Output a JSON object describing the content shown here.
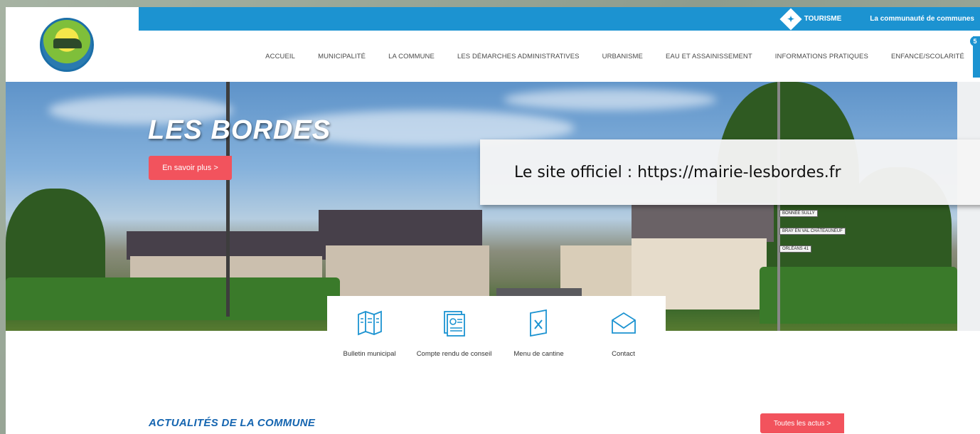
{
  "topbar": {
    "tourisme_label": "TOURISME",
    "communaute_label": "La communauté de communes"
  },
  "nav": {
    "items": [
      {
        "label": "ACCUEIL"
      },
      {
        "label": "MUNICIPALITÉ"
      },
      {
        "label": "LA COMMUNE"
      },
      {
        "label": "LES DÉMARCHES ADMINISTRATIVES"
      },
      {
        "label": "URBANISME"
      },
      {
        "label": "EAU ET ASSAINISSEMENT"
      },
      {
        "label": "INFORMATIONS PRATIQUES"
      },
      {
        "label": "ENFANCE/SCOLARITÉ"
      }
    ],
    "badge_count": "5"
  },
  "hero": {
    "title": "LES BORDES",
    "button_label": "En savoir plus >"
  },
  "overlay": {
    "text": "Le site officiel  : https://mairie-lesbordes.fr"
  },
  "quick_access": [
    {
      "label": "Bulletin municipal",
      "icon": "map-icon"
    },
    {
      "label": "Compte rendu de conseil",
      "icon": "report-icon"
    },
    {
      "label": "Menu de cantine",
      "icon": "menu-icon"
    },
    {
      "label": "Contact",
      "icon": "envelope-icon"
    }
  ],
  "news": {
    "title": "ACTUALITÉS DE LA COMMUNE",
    "all_label": "Toutes les actus >"
  },
  "colors": {
    "primary_blue": "#1c93d1",
    "accent_red": "#f2535d",
    "title_blue": "#1565b0"
  }
}
